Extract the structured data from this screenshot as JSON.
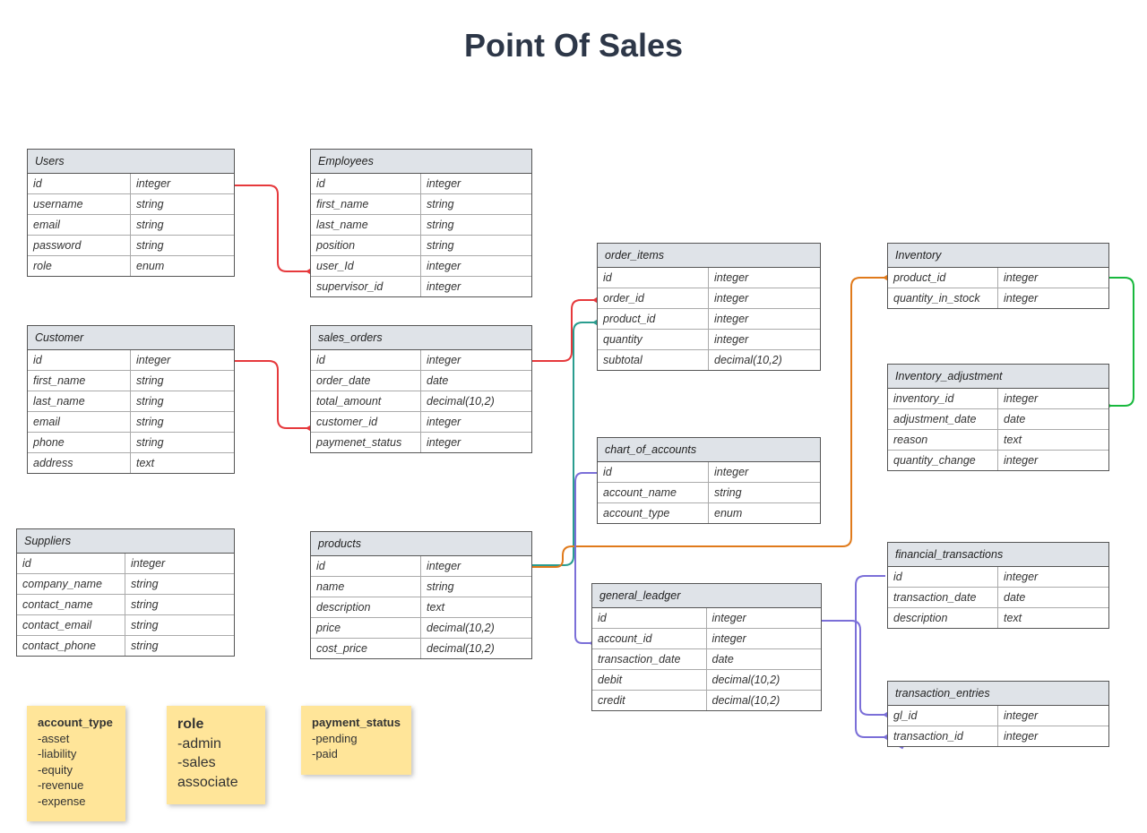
{
  "title": "Point Of Sales",
  "tables": {
    "users": {
      "name": "Users",
      "rows": [
        [
          "id",
          "integer"
        ],
        [
          "username",
          "string"
        ],
        [
          "email",
          "string"
        ],
        [
          "password",
          "string"
        ],
        [
          "role",
          "enum"
        ]
      ]
    },
    "employees": {
      "name": "Employees",
      "rows": [
        [
          "id",
          "integer"
        ],
        [
          "first_name",
          "string"
        ],
        [
          "last_name",
          "string"
        ],
        [
          "position",
          "string"
        ],
        [
          "user_Id",
          "integer"
        ],
        [
          "supervisor_id",
          "integer"
        ]
      ]
    },
    "customer": {
      "name": "Customer",
      "rows": [
        [
          "id",
          "integer"
        ],
        [
          "first_name",
          "string"
        ],
        [
          "last_name",
          "string"
        ],
        [
          "email",
          "string"
        ],
        [
          "phone",
          "string"
        ],
        [
          "address",
          "text"
        ]
      ]
    },
    "sales_orders": {
      "name": "sales_orders",
      "rows": [
        [
          "id",
          "integer"
        ],
        [
          "order_date",
          "date"
        ],
        [
          "total_amount",
          "decimal(10,2)"
        ],
        [
          "customer_id",
          "integer"
        ],
        [
          "paymenet_status",
          "integer"
        ]
      ]
    },
    "order_items": {
      "name": "order_items",
      "rows": [
        [
          "id",
          "integer"
        ],
        [
          "order_id",
          "integer"
        ],
        [
          "product_id",
          "integer"
        ],
        [
          "quantity",
          "integer"
        ],
        [
          "subtotal",
          "decimal(10,2)"
        ]
      ]
    },
    "inventory": {
      "name": "Inventory",
      "rows": [
        [
          "product_id",
          "integer"
        ],
        [
          "quantity_in_stock",
          "integer"
        ]
      ]
    },
    "inventory_adjustment": {
      "name": "Inventory_adjustment",
      "rows": [
        [
          "inventory_id",
          "integer"
        ],
        [
          "adjustment_date",
          "date"
        ],
        [
          "reason",
          "text"
        ],
        [
          "quantity_change",
          "integer"
        ]
      ]
    },
    "suppliers": {
      "name": "Suppliers",
      "rows": [
        [
          "id",
          "integer"
        ],
        [
          "company_name",
          "string"
        ],
        [
          "contact_name",
          "string"
        ],
        [
          "contact_email",
          "string"
        ],
        [
          "contact_phone",
          "string"
        ]
      ]
    },
    "products": {
      "name": "products",
      "rows": [
        [
          "id",
          "integer"
        ],
        [
          "name",
          "string"
        ],
        [
          "description",
          "text"
        ],
        [
          "price",
          "decimal(10,2)"
        ],
        [
          "cost_price",
          "decimal(10,2)"
        ]
      ]
    },
    "chart_of_accounts": {
      "name": "chart_of_accounts",
      "rows": [
        [
          "id",
          "integer"
        ],
        [
          "account_name",
          "string"
        ],
        [
          "account_type",
          "enum"
        ]
      ]
    },
    "general_leadger": {
      "name": "general_leadger",
      "rows": [
        [
          "id",
          "integer"
        ],
        [
          "account_id",
          "integer"
        ],
        [
          "transaction_date",
          "date"
        ],
        [
          "debit",
          "decimal(10,2)"
        ],
        [
          "credit",
          "decimal(10,2)"
        ]
      ]
    },
    "financial_transactions": {
      "name": "financial_transactions",
      "rows": [
        [
          "id",
          "integer"
        ],
        [
          "transaction_date",
          "date"
        ],
        [
          "description",
          "text"
        ]
      ]
    },
    "transaction_entries": {
      "name": "transaction_entries",
      "rows": [
        [
          "gl_id",
          "integer"
        ],
        [
          "transaction_id",
          "integer"
        ]
      ]
    }
  },
  "stickies": {
    "account_type": {
      "title": "account_type",
      "lines": [
        "-asset",
        "-liability",
        "-equity",
        "-revenue",
        "-expense"
      ]
    },
    "role": {
      "title": "role",
      "lines": [
        "-admin",
        "-sales",
        "associate"
      ]
    },
    "payment_status": {
      "title": "payment_status",
      "lines": [
        "-pending",
        "-paid"
      ]
    }
  },
  "colors": {
    "red": "#e6393c",
    "green": "#2a9d8f",
    "brightgreen": "#18b83d",
    "orange": "#e07a1b",
    "purple": "#7b6fd8"
  }
}
